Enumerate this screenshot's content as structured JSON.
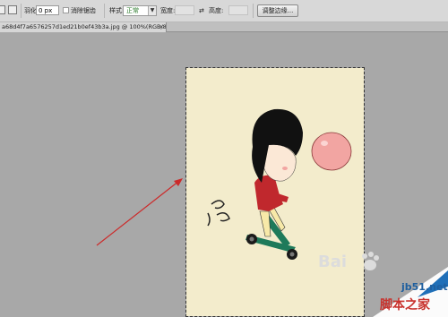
{
  "options_bar": {
    "feather_label": "羽化:",
    "feather_value": "0 px",
    "antialias_label": "消除锯齿",
    "style_label": "样式:",
    "style_value": "正常",
    "width_label": "宽度:",
    "height_label": "高度:",
    "refine_edge_label": "调整边缘..."
  },
  "tab": {
    "title": "a68d4f7a6576257d1ed21b0ef43b3a.jpg @ 100%(RGB/8#)",
    "close_glyph": "×"
  },
  "watermarks": {
    "baidu": "Bai",
    "site": "jb51.net",
    "site_cn": "脚本之家"
  },
  "colors": {
    "canvas_bg": "#f3eccc",
    "arrow": "#cc2a2a",
    "gum": "#f2a5a2",
    "hair": "#111111",
    "shirt": "#c0282d",
    "scooter": "#1e7a5a"
  }
}
